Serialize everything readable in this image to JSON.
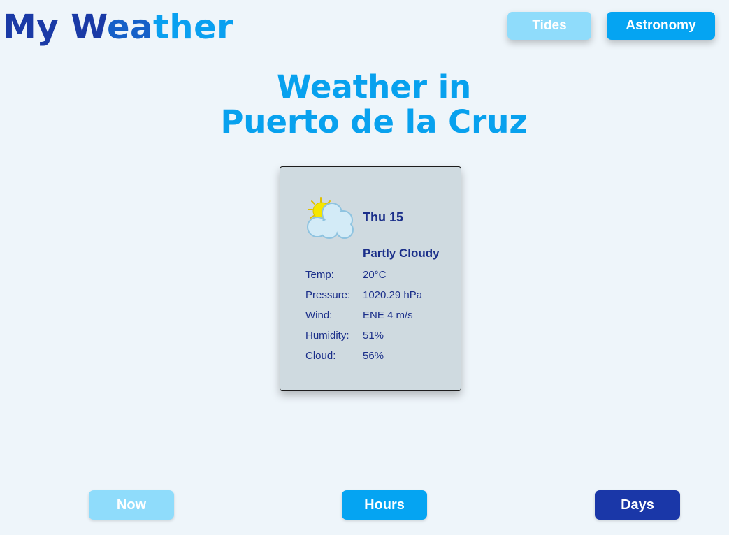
{
  "header": {
    "title_part1": "My W",
    "title_part2": "ea",
    "title_part3": "ther",
    "tides_label": "Tides",
    "astronomy_label": "Astronomy"
  },
  "main": {
    "heading_line1": "Weather in",
    "heading_line2": "Puerto de la Cruz"
  },
  "card": {
    "icon": "partly-cloudy-icon",
    "day": "Thu 15",
    "condition": "Partly Cloudy",
    "rows": [
      {
        "label": "Temp:",
        "value": "20°C"
      },
      {
        "label": "Pressure:",
        "value": "1020.29 hPa"
      },
      {
        "label": "Wind:",
        "value": "ENE 4 m/s"
      },
      {
        "label": "Humidity:",
        "value": "51%"
      },
      {
        "label": "Cloud:",
        "value": "56%"
      }
    ]
  },
  "footer": {
    "now_label": "Now",
    "hours_label": "Hours",
    "days_label": "Days"
  },
  "colors": {
    "background": "#eef5fa",
    "accent": "#05a4f2",
    "light_accent": "#8fdcfb",
    "dark_accent": "#1a37a8",
    "card_bg": "#cfdae0",
    "card_text": "#1b2f8a"
  }
}
